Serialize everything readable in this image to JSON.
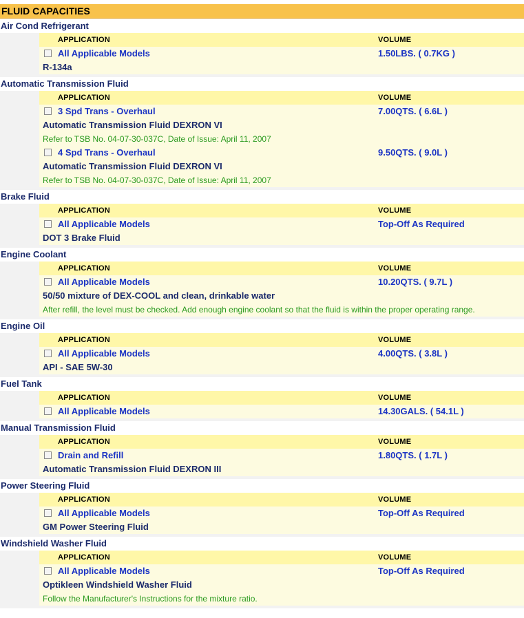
{
  "page_title": "FLUID CAPACITIES",
  "col_application": "APPLICATION",
  "col_volume": "VOLUME",
  "sections": [
    {
      "title": "Air Cond Refrigerant",
      "entries": [
        {
          "application": "All Applicable Models",
          "volume": "1.50LBS. ( 0.7KG )",
          "fluid": "R-134a",
          "note": ""
        }
      ]
    },
    {
      "title": "Automatic Transmission Fluid",
      "entries": [
        {
          "application": "3 Spd Trans - Overhaul",
          "volume": "7.00QTS. ( 6.6L )",
          "fluid": "Automatic Transmission Fluid DEXRON VI",
          "note": "Refer to TSB No. 04-07-30-037C, Date of Issue: April 11, 2007"
        },
        {
          "application": "4 Spd Trans - Overhaul",
          "volume": "9.50QTS. ( 9.0L )",
          "fluid": "Automatic Transmission Fluid DEXRON VI",
          "note": "Refer to TSB No. 04-07-30-037C, Date of Issue: April 11, 2007"
        }
      ]
    },
    {
      "title": "Brake Fluid",
      "entries": [
        {
          "application": "All Applicable Models",
          "volume": "Top-Off As Required",
          "fluid": "DOT 3 Brake Fluid",
          "note": ""
        }
      ]
    },
    {
      "title": "Engine Coolant",
      "entries": [
        {
          "application": "All Applicable Models",
          "volume": "10.20QTS. ( 9.7L )",
          "fluid": "50/50 mixture of DEX-COOL and clean, drinkable water",
          "note": "After refill, the level must be checked. Add enough engine coolant so that the fluid is within the proper operating range."
        }
      ]
    },
    {
      "title": "Engine Oil",
      "entries": [
        {
          "application": "All Applicable Models",
          "volume": "4.00QTS. ( 3.8L )",
          "fluid": "API - SAE 5W-30",
          "note": ""
        }
      ]
    },
    {
      "title": "Fuel Tank",
      "entries": [
        {
          "application": "All Applicable Models",
          "volume": "14.30GALS. ( 54.1L )",
          "fluid": "",
          "note": ""
        }
      ]
    },
    {
      "title": "Manual Transmission Fluid",
      "entries": [
        {
          "application": "Drain and Refill",
          "volume": "1.80QTS. ( 1.7L )",
          "fluid": "Automatic Transmission Fluid DEXRON III",
          "note": ""
        }
      ]
    },
    {
      "title": "Power Steering Fluid",
      "entries": [
        {
          "application": "All Applicable Models",
          "volume": "Top-Off As Required",
          "fluid": "GM Power Steering Fluid",
          "note": ""
        }
      ]
    },
    {
      "title": "Windshield Washer Fluid",
      "entries": [
        {
          "application": "All Applicable Models",
          "volume": "Top-Off As Required",
          "fluid": "Optikleen Windshield Washer Fluid",
          "note": "Follow the Manufacturer's Instructions for the mixture ratio."
        }
      ]
    }
  ]
}
